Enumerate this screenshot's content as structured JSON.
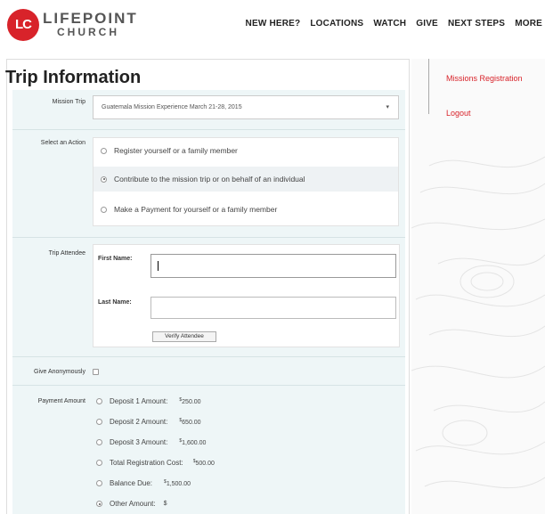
{
  "brand": {
    "badge": "LC",
    "name_line1": "LIFEPOINT",
    "name_line2": "CHURCH",
    "accent": "#d8232a"
  },
  "nav": [
    "NEW HERE?",
    "LOCATIONS",
    "WATCH",
    "GIVE",
    "NEXT STEPS",
    "MORE"
  ],
  "page_title": "Trip Information",
  "form": {
    "mission_trip": {
      "label": "Mission Trip",
      "selected": "Guatemala Mission Experience March 21-28, 2015"
    },
    "action": {
      "label": "Select an Action",
      "options": [
        {
          "text": "Register yourself or a family member",
          "selected": false
        },
        {
          "text": "Contribute to the mission trip or on behalf of an individual",
          "selected": true
        },
        {
          "text": "Make a Payment for yourself or a family member",
          "selected": false
        }
      ]
    },
    "attendee": {
      "label": "Trip Attendee",
      "first_name_label": "First Name:",
      "first_name_value": "",
      "last_name_label": "Last Name:",
      "last_name_value": "",
      "verify_button": "Verify Attendee"
    },
    "anonymous": {
      "label": "Give Anonymously",
      "checked": false
    },
    "payment": {
      "label": "Payment Amount",
      "options": [
        {
          "label": "Deposit 1 Amount:",
          "currency": "$",
          "amount": "250.00",
          "selected": false
        },
        {
          "label": "Deposit 2 Amount:",
          "currency": "$",
          "amount": "650.00",
          "selected": false
        },
        {
          "label": "Deposit 3 Amount:",
          "currency": "$",
          "amount": "1,600.00",
          "selected": false
        },
        {
          "label": "Total Registration Cost:",
          "currency": "$",
          "amount": "500.00",
          "selected": false
        },
        {
          "label": "Balance Due:",
          "currency": "$",
          "amount": "1,500.00",
          "selected": false
        },
        {
          "label": "Other Amount:",
          "currency": "$",
          "amount": "",
          "selected": true
        }
      ]
    }
  },
  "sidebar": {
    "links": [
      "Missions Registration",
      "Logout"
    ]
  }
}
